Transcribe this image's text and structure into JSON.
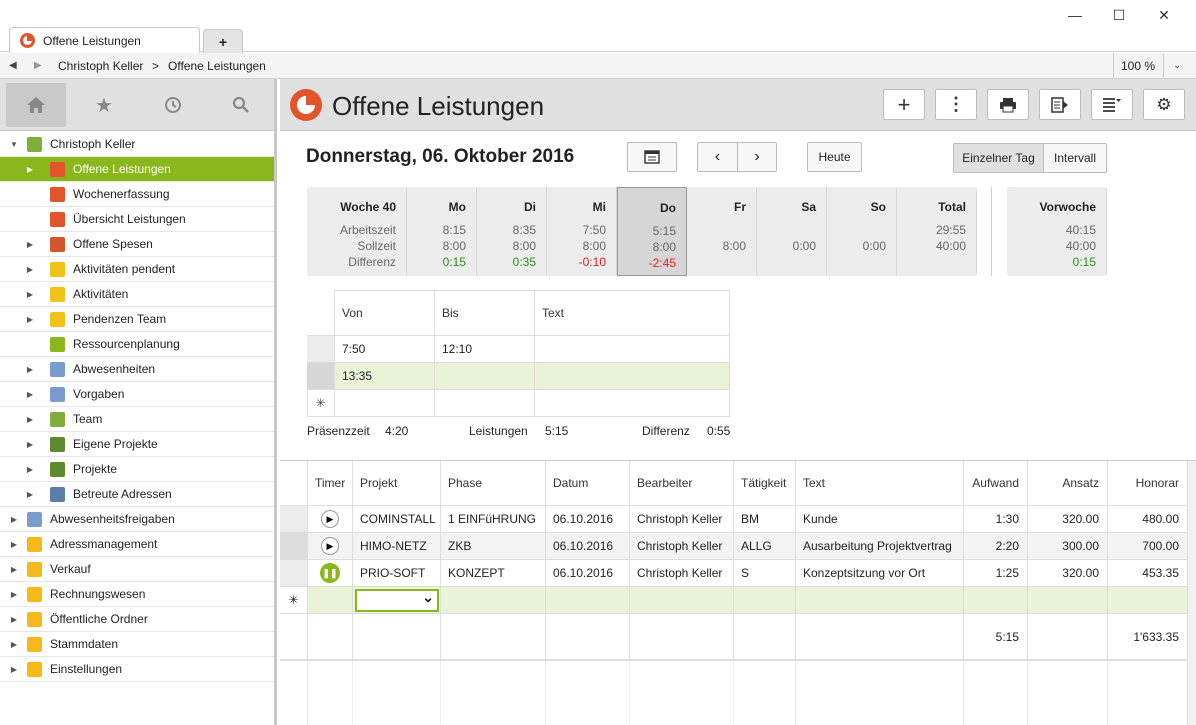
{
  "window": {
    "tab_title": "Offene Leistungen",
    "new_tab": "+",
    "minimize": "—",
    "maximize": "☐",
    "close": "✕"
  },
  "address": {
    "breadcrumb": [
      "Christoph Keller",
      "Offene Leistungen"
    ],
    "separator": ">",
    "zoom": "100 %"
  },
  "sidebar": {
    "tree": [
      {
        "label": "Christoph Keller",
        "level": 0,
        "expanded": true,
        "icon": "user-icon",
        "color": "#7fae3a"
      },
      {
        "label": "Offene Leistungen",
        "level": 1,
        "selected": true,
        "icon": "clock-pie-icon",
        "color": "#e2552a"
      },
      {
        "label": "Wochenerfassung",
        "level": 1,
        "icon": "calendar-pie-icon",
        "color": "#e2552a"
      },
      {
        "label": "Übersicht Leistungen",
        "level": 1,
        "icon": "target-icon",
        "color": "#e2552a"
      },
      {
        "label": "Offene Spesen",
        "level": 1,
        "icon": "receipt-icon",
        "color": "#d0572a"
      },
      {
        "label": "Aktivitäten pendent",
        "level": 1,
        "icon": "star-icon",
        "color": "#f0c21a"
      },
      {
        "label": "Aktivitäten",
        "level": 1,
        "icon": "star-icon",
        "color": "#f0c21a"
      },
      {
        "label": "Pendenzen Team",
        "level": 1,
        "icon": "star-icon",
        "color": "#f0c21a"
      },
      {
        "label": "Ressourcenplanung",
        "level": 1,
        "icon": "pie-chart-icon",
        "color": "#8ab71c"
      },
      {
        "label": "Abwesenheiten",
        "level": 1,
        "icon": "person-icon",
        "color": "#7a9ccc"
      },
      {
        "label": "Vorgaben",
        "level": 1,
        "icon": "person-gear-icon",
        "color": "#7a9ccc"
      },
      {
        "label": "Team",
        "level": 1,
        "icon": "user-icon",
        "color": "#7fae3a"
      },
      {
        "label": "Eigene Projekte",
        "level": 1,
        "icon": "project-book-icon",
        "color": "#5c8a2e"
      },
      {
        "label": "Projekte",
        "level": 1,
        "icon": "project-book-icon",
        "color": "#5c8a2e"
      },
      {
        "label": "Betreute Adressen",
        "level": 1,
        "icon": "building-icon",
        "color": "#5b7da8"
      },
      {
        "label": "Abwesenheitsfreigaben",
        "level": 0,
        "icon": "person-icon",
        "color": "#7a9ccc"
      },
      {
        "label": "Adressmanagement",
        "level": 0,
        "icon": "folder-icon",
        "color": "#f5b91a"
      },
      {
        "label": "Verkauf",
        "level": 0,
        "icon": "folder-icon",
        "color": "#f5b91a"
      },
      {
        "label": "Rechnungswesen",
        "level": 0,
        "icon": "folder-icon",
        "color": "#f5b91a"
      },
      {
        "label": "Öffentliche Ordner",
        "level": 0,
        "icon": "folder-icon",
        "color": "#f5b91a"
      },
      {
        "label": "Stammdaten",
        "level": 0,
        "icon": "folder-icon",
        "color": "#f5b91a"
      },
      {
        "label": "Einstellungen",
        "level": 0,
        "icon": "folder-heart-icon",
        "color": "#f5b91a"
      }
    ]
  },
  "main": {
    "title": "Offene Leistungen",
    "date": "Donnerstag, 06. Oktober 2016",
    "today_button": "Heute",
    "view_toggle": [
      "Einzelner Tag",
      "Intervall"
    ],
    "week": {
      "header": "Woche 40",
      "row_labels": [
        "Arbeitszeit",
        "Sollzeit",
        "Differenz"
      ],
      "days": [
        {
          "name": "Mo",
          "arbeitszeit": "8:15",
          "sollzeit": "8:00",
          "differenz": "0:15",
          "diff_status": "positive"
        },
        {
          "name": "Di",
          "arbeitszeit": "8:35",
          "sollzeit": "8:00",
          "differenz": "0:35",
          "diff_status": "positive"
        },
        {
          "name": "Mi",
          "arbeitszeit": "7:50",
          "sollzeit": "8:00",
          "differenz": "-0:10",
          "diff_status": "negative"
        },
        {
          "name": "Do",
          "arbeitszeit": "5:15",
          "sollzeit": "8:00",
          "differenz": "-2:45",
          "diff_status": "negative",
          "selected": true
        },
        {
          "name": "Fr",
          "arbeitszeit": "",
          "sollzeit": "8:00",
          "differenz": ""
        },
        {
          "name": "Sa",
          "arbeitszeit": "",
          "sollzeit": "0:00",
          "differenz": ""
        },
        {
          "name": "So",
          "arbeitszeit": "",
          "sollzeit": "0:00",
          "differenz": ""
        },
        {
          "name": "Total",
          "arbeitszeit": "29:55",
          "sollzeit": "40:00",
          "differenz": ""
        }
      ],
      "previous": {
        "name": "Vorwoche",
        "arbeitszeit": "40:15",
        "sollzeit": "40:00",
        "differenz": "0:15"
      }
    },
    "presence": {
      "headers": [
        "Von",
        "Bis",
        "Text"
      ],
      "rows": [
        {
          "von": "7:50",
          "bis": "12:10",
          "text": ""
        },
        {
          "von": "13:35",
          "bis": "",
          "text": ""
        }
      ],
      "new_row_marker": "✳",
      "summary": {
        "praesenzzeit_label": "Präsenzzeit",
        "praesenzzeit": "4:20",
        "leistungen_label": "Leistungen",
        "leistungen": "5:15",
        "differenz_label": "Differenz",
        "differenz": "0:55"
      }
    },
    "services": {
      "headers": [
        "Timer",
        "Projekt",
        "Phase",
        "Datum",
        "Bearbeiter",
        "Tätigkeit",
        "Text",
        "Aufwand",
        "Ansatz",
        "Honorar"
      ],
      "rows": [
        {
          "timer": "play",
          "projekt": "COMINSTALL",
          "phase": "1 EINFüHRUNG",
          "datum": "06.10.2016",
          "bearbeiter": "Christoph Keller",
          "taetigkeit": "BM",
          "text": "Kunde",
          "aufwand": "1:30",
          "ansatz": "320.00",
          "honorar": "480.00"
        },
        {
          "timer": "play",
          "projekt": "HIMO-NETZ",
          "phase": "ZKB",
          "datum": "06.10.2016",
          "bearbeiter": "Christoph Keller",
          "taetigkeit": "ALLG",
          "text": "Ausarbeitung Projektvertrag",
          "aufwand": "2:20",
          "ansatz": "300.00",
          "honorar": "700.00"
        },
        {
          "timer": "pause",
          "projekt": "PRIO-SOFT",
          "phase": "KONZEPT",
          "datum": "06.10.2016",
          "bearbeiter": "Christoph Keller",
          "taetigkeit": "S",
          "text": "Konzeptsitzung vor Ort",
          "aufwand": "1:25",
          "ansatz": "320.00",
          "honorar": "453.35"
        }
      ],
      "totals": {
        "aufwand": "5:15",
        "honorar": "1'633.35"
      },
      "new_row_marker": "✳"
    }
  }
}
